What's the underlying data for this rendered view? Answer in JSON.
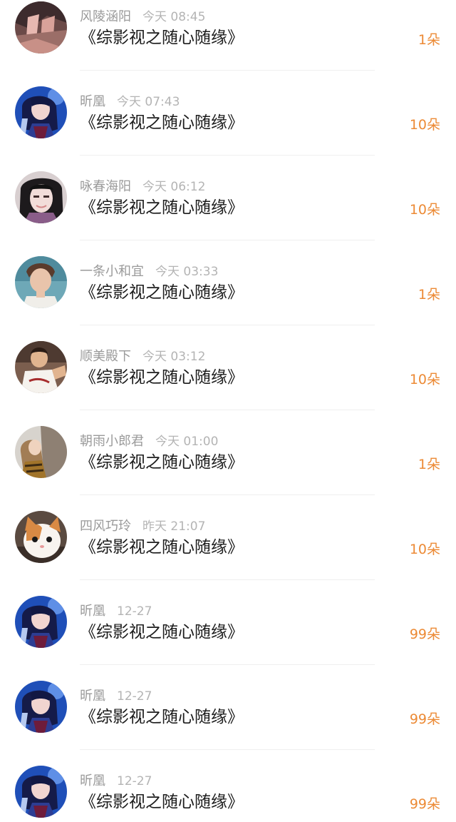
{
  "colors": {
    "name": "#9a9a9a",
    "time": "#b4b4b4",
    "title": "#1c1c1c",
    "gift": "#ec8a35",
    "divider": "#efefef"
  },
  "records": [
    {
      "name": "风陵涵阳",
      "time": "今天 08:45",
      "title": "《综影视之随心随缘》",
      "gift": "1朵",
      "avatar": "photo-avatar-icon"
    },
    {
      "name": "昕凰",
      "time": "今天 07:43",
      "title": "《综影视之随心随缘》",
      "gift": "10朵",
      "avatar": "anime-girl-avatar-icon"
    },
    {
      "name": "咏春海阳",
      "time": "今天 06:12",
      "title": "《综影视之随心随缘》",
      "gift": "10朵",
      "avatar": "photo-avatar-icon"
    },
    {
      "name": "一条小和宜",
      "time": "今天 03:33",
      "title": "《综影视之随心随缘》",
      "gift": "1朵",
      "avatar": "photo-avatar-icon"
    },
    {
      "name": "顺美殿下",
      "time": "今天 03:12",
      "title": "《综影视之随心随缘》",
      "gift": "10朵",
      "avatar": "photo-avatar-icon"
    },
    {
      "name": "朝雨小郎君",
      "time": "今天 01:00",
      "title": "《综影视之随心随缘》",
      "gift": "1朵",
      "avatar": "photo-avatar-icon"
    },
    {
      "name": "四风巧玲",
      "time": "昨天 21:07",
      "title": "《综影视之随心随缘》",
      "gift": "10朵",
      "avatar": "cat-avatar-icon"
    },
    {
      "name": "昕凰",
      "time": "12-27",
      "title": "《综影视之随心随缘》",
      "gift": "99朵",
      "avatar": "anime-girl-avatar-icon"
    },
    {
      "name": "昕凰",
      "time": "12-27",
      "title": "《综影视之随心随缘》",
      "gift": "99朵",
      "avatar": "anime-girl-avatar-icon"
    },
    {
      "name": "昕凰",
      "time": "12-27",
      "title": "《综影视之随心随缘》",
      "gift": "99朵",
      "avatar": "anime-girl-avatar-icon"
    }
  ]
}
